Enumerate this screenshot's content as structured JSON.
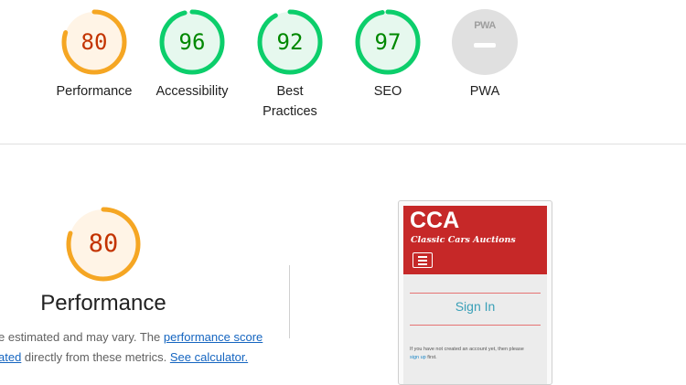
{
  "scores": [
    {
      "value": "80",
      "label": "Performance",
      "level": 80,
      "color": "#f5a623",
      "bg": "#fff4e6",
      "text": "#c33300"
    },
    {
      "value": "96",
      "label": "Accessibility",
      "level": 96,
      "color": "#0cce6b",
      "bg": "#e6f8ee",
      "text": "#008800"
    },
    {
      "value": "92",
      "label": "Best Practices",
      "level": 92,
      "color": "#0cce6b",
      "bg": "#e6f8ee",
      "text": "#008800"
    },
    {
      "value": "97",
      "label": "SEO",
      "level": 97,
      "color": "#0cce6b",
      "bg": "#e6f8ee",
      "text": "#008800"
    },
    {
      "value": "",
      "label": "PWA",
      "badge": "PWA",
      "color": "#e0e0e0"
    }
  ],
  "performance": {
    "score": "80",
    "level": 80,
    "title": "Performance",
    "desc_line1_text": "e estimated and may vary. The ",
    "desc_line1_link": "performance score",
    "desc_line2_link1": "ated",
    "desc_line2_text": " directly from these metrics. ",
    "desc_line2_link2": "See calculator."
  },
  "screenshot": {
    "logo": "CCA",
    "tagline": "Classic Cars Auctions",
    "signin": "Sign In",
    "note_text": "If you have not created an account yet, then please",
    "note_link": "sign up",
    "note_end": " first."
  }
}
